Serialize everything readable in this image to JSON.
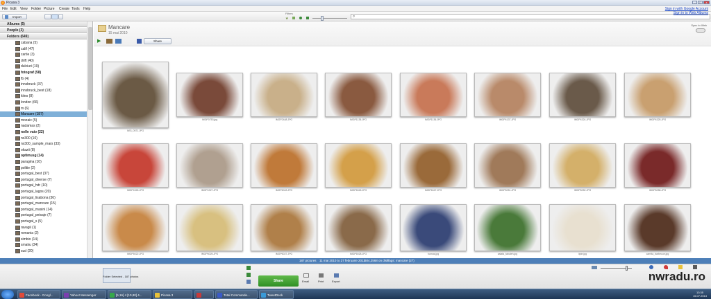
{
  "app": {
    "title": "Picasa 3",
    "window_buttons": [
      "_",
      "□",
      "x"
    ]
  },
  "menu": [
    "File",
    "Edit",
    "View",
    "Folder",
    "Picture",
    "Create",
    "Tools",
    "Help"
  ],
  "account": {
    "sign_in": "Sign in with Google Account",
    "sign_in2": "Sign in to Web Albums"
  },
  "toolbar": {
    "import_label": "Import",
    "filters_label": "Filters",
    "search_placeholder": ""
  },
  "sidebar": {
    "albums": "Albums (5)",
    "people": "People (3)",
    "folders": "Folders (649)",
    "items": [
      {
        "label": "cabana (5)"
      },
      {
        "label": "calif (47)"
      },
      {
        "label": "cartie (3)"
      },
      {
        "label": "drift (40)"
      },
      {
        "label": "dulciuri (19)"
      },
      {
        "label": "fotograf (58)",
        "bold": true
      },
      {
        "label": "fb (4)"
      },
      {
        "label": "innsbruck (37)"
      },
      {
        "label": "innsbruck_best (18)"
      },
      {
        "label": "kites (8)"
      },
      {
        "label": "london (66)"
      },
      {
        "label": "m (6)"
      },
      {
        "label": "Mancare (187)",
        "selected": true
      },
      {
        "label": "mozaic (5)"
      },
      {
        "label": "nadamas (2)"
      },
      {
        "label": "nolle vaio (22)",
        "bold": true
      },
      {
        "label": "nx300 (10)"
      },
      {
        "label": "nx300_sample_mars (33)"
      },
      {
        "label": "okazii (8)"
      },
      {
        "label": "optimusg (14)",
        "bold": true
      },
      {
        "label": "paragina (10)"
      },
      {
        "label": "politie (2)"
      },
      {
        "label": "portugal_best (37)"
      },
      {
        "label": "portugal_diverse (7)"
      },
      {
        "label": "portugal_hdr (10)"
      },
      {
        "label": "portugal_lagos (20)"
      },
      {
        "label": "portugal_lisabona (36)"
      },
      {
        "label": "portugal_mancare (15)"
      },
      {
        "label": "portugal_masini (14)"
      },
      {
        "label": "portugal_peisaje (7)"
      },
      {
        "label": "portugal_s (5)"
      },
      {
        "label": "ravagii (1)"
      },
      {
        "label": "romania (2)"
      },
      {
        "label": "simbio (14)"
      },
      {
        "label": "smaku (34)"
      },
      {
        "label": "sud (20)"
      }
    ]
  },
  "folder": {
    "name": "Mancare",
    "date": "15 mai 2010",
    "share_label": "Share",
    "sync_label": "Sync to Web"
  },
  "photos": [
    {
      "caption": "IMG_0571.JPG",
      "c": "#6b5a45"
    },
    {
      "caption": "IMGP0753.jpg",
      "c": "#7a4a3a"
    },
    {
      "caption": "IMGP2448.JPG",
      "c": "#c9b08a"
    },
    {
      "caption": "IMGP1135.JPG",
      "c": "#8a5a40"
    },
    {
      "caption": "IMGP1136.JPG",
      "c": "#c97a5a"
    },
    {
      "caption": "IMGP4137.JPG",
      "c": "#b98a6a"
    },
    {
      "caption": "IMGP4324.JPG",
      "c": "#6a5a4a"
    },
    {
      "caption": "IMGP4325.JPG",
      "c": "#c9a070"
    },
    {
      "caption": "IMGP4326.JPG",
      "c": "#c8463a"
    },
    {
      "caption": "IMGP4327.JPG",
      "c": "#b0a090"
    },
    {
      "caption": "IMGP6043.JPG",
      "c": "#c07a3a"
    },
    {
      "caption": "IMGP6045.JPG",
      "c": "#d4a04a"
    },
    {
      "caption": "IMGP6047.JPG",
      "c": "#9a6a3a"
    },
    {
      "caption": "IMGP6051.JPG",
      "c": "#a07a5a"
    },
    {
      "caption": "IMGP6052.JPG",
      "c": "#d4b06a"
    },
    {
      "caption": "IMGP6058.JPG",
      "c": "#7a2a2a"
    },
    {
      "caption": "IMGP6022.JPG",
      "c": "#c98a4a"
    },
    {
      "caption": "IMGP6025.JPG",
      "c": "#d8c080"
    },
    {
      "caption": "IMGP6027.JPG",
      "c": "#b0804a"
    },
    {
      "caption": "IMGP6028.JPG",
      "c": "#8a6a4a"
    },
    {
      "caption": "humus.jpg",
      "c": "#3a4a7a"
    },
    {
      "caption": "salata_tabuleh.jpg",
      "c": "#4a7a3a"
    },
    {
      "caption": "lipie.jpg",
      "c": "#e8e0d0"
    },
    {
      "caption": "carnita_barbecue.jpg",
      "c": "#5a3a2a"
    }
  ],
  "status": {
    "count": "187 pictures",
    "range": "11 mai 2010 to 27 februarie 2013",
    "size": "604,2568 on disk",
    "tags": "Tags: mancare (27)"
  },
  "tray": {
    "selection": "Folder Selected - 187 photos",
    "share": "Share",
    "email": "Email",
    "print": "Print",
    "export": "Export"
  },
  "taskbar": {
    "items": [
      {
        "label": "Facebook - Googl...",
        "c": "#e24a3a"
      },
      {
        "label": "Yahoo! Messenger",
        "c": "#7b3fb0"
      },
      {
        "label": "[5,16] 4 [10,80] 4...",
        "c": "#35a84a"
      },
      {
        "label": "Picasa 3",
        "c": "#e8c23a"
      },
      {
        "label": "",
        "c": "#c83a3a"
      },
      {
        "label": "Total Commande...",
        "c": "#3a5ac8"
      },
      {
        "label": "TweetDeck",
        "c": "#3a9ad8"
      }
    ],
    "time": "13:35",
    "date": "15.07.2013"
  },
  "watermark": "nwradu.ro"
}
